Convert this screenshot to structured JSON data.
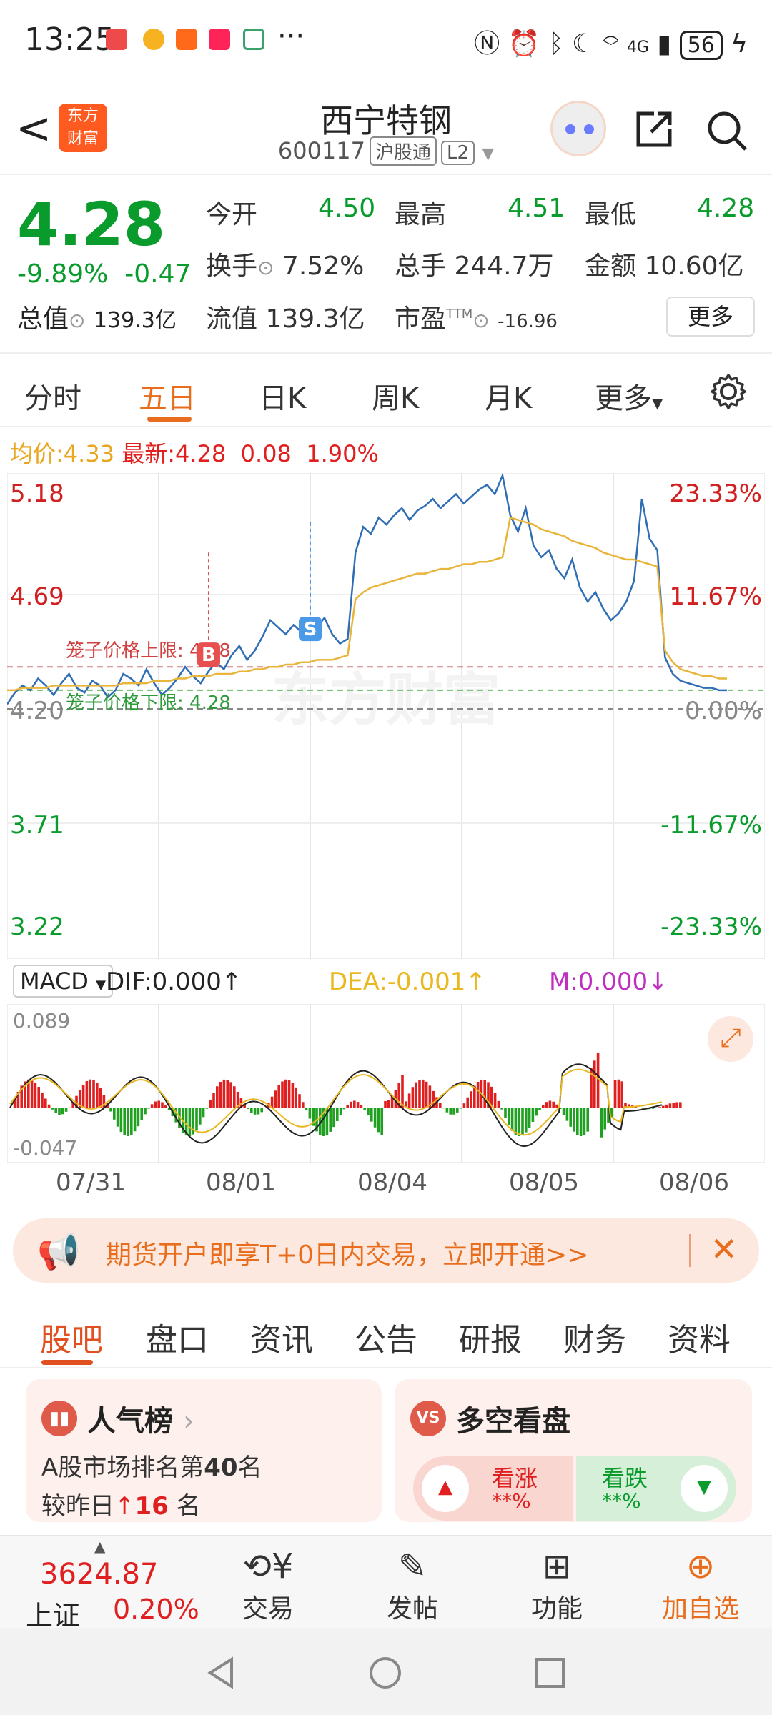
{
  "status_bar": {
    "time": "13:25",
    "battery": "56",
    "signal": "4G"
  },
  "header": {
    "back": "<",
    "logo_line1": "东方",
    "logo_line2": "财富",
    "stock_name": "西宁特钢",
    "stock_code": "600117",
    "tag_hgt": "沪股通",
    "tag_level": "L2"
  },
  "quote": {
    "price": "4.28",
    "change_pct": "-9.89%",
    "change": "-0.47",
    "open_label": "今开",
    "open": "4.50",
    "high_label": "最高",
    "high": "4.51",
    "low_label": "最低",
    "low": "4.28",
    "turnover_label": "换手",
    "turnover": "7.52%",
    "volume_label": "总手",
    "volume": "244.7万",
    "amount_label": "金额",
    "amount": "10.60亿",
    "mktcap_label": "总值",
    "mktcap": "139.3亿",
    "float_label": "流值",
    "float": "139.3亿",
    "pe_label": "市盈",
    "pe_sup": "TTM",
    "pe": "-16.96",
    "more": "更多"
  },
  "tabs": [
    "分时",
    "五日",
    "日K",
    "周K",
    "月K",
    "更多"
  ],
  "avg_line": {
    "avg_label": "均价:",
    "avg": "4.33",
    "latest_label": "最新:",
    "latest": "4.28",
    "diff": "0.08",
    "diff_pct": "1.90%"
  },
  "chart_data": {
    "type": "line",
    "y_left_ticks": [
      "5.18",
      "4.69",
      "4.20",
      "3.71",
      "3.22"
    ],
    "y_right_ticks": [
      "23.33%",
      "11.67%",
      "0.00%",
      "-11.67%",
      "-23.33%"
    ],
    "x_labels": [
      "07/31",
      "08/01",
      "08/04",
      "08/05",
      "08/06"
    ],
    "upper_limit_label": "笼子价格上限: 4.38",
    "lower_limit_label": "笼子价格下限: 4.28",
    "buy_marker": "B",
    "sell_marker": "S",
    "watermark": "东方财富",
    "ylim": [
      3.22,
      5.18
    ],
    "series": [
      {
        "name": "price",
        "color": "#2f6db5",
        "values": [
          4.22,
          4.27,
          4.3,
          4.28,
          4.33,
          4.3,
          4.26,
          4.31,
          4.35,
          4.29,
          4.27,
          4.32,
          4.3,
          4.25,
          4.28,
          4.35,
          4.33,
          4.3,
          4.37,
          4.31,
          4.26,
          4.29,
          4.33,
          4.38,
          4.34,
          4.31,
          4.36,
          4.4,
          4.37,
          4.43,
          4.47,
          4.41,
          4.45,
          4.51,
          4.58,
          4.55,
          4.52,
          4.56,
          4.53,
          4.57,
          4.55,
          4.59,
          4.52,
          4.48,
          4.5,
          4.87,
          4.98,
          4.95,
          5.02,
          4.99,
          5.03,
          5.06,
          5.01,
          5.05,
          5.07,
          5.1,
          5.06,
          5.09,
          5.12,
          5.08,
          5.11,
          5.14,
          5.16,
          5.12,
          5.2,
          5.03,
          4.96,
          5.06,
          4.9,
          4.85,
          4.88,
          4.8,
          4.76,
          4.84,
          4.72,
          4.66,
          4.7,
          4.63,
          4.58,
          4.61,
          4.66,
          4.75,
          5.1,
          4.93,
          4.88,
          4.42,
          4.35,
          4.32,
          4.31,
          4.3,
          4.29,
          4.29,
          4.28,
          4.28
        ]
      },
      {
        "name": "avg",
        "color": "#e9b43a",
        "values": [
          4.28,
          4.28,
          4.29,
          4.29,
          4.29,
          4.29,
          4.3,
          4.3,
          4.3,
          4.3,
          4.3,
          4.3,
          4.3,
          4.3,
          4.3,
          4.31,
          4.31,
          4.31,
          4.31,
          4.32,
          4.32,
          4.32,
          4.33,
          4.33,
          4.34,
          4.34,
          4.34,
          4.35,
          4.35,
          4.35,
          4.36,
          4.36,
          4.37,
          4.37,
          4.38,
          4.38,
          4.39,
          4.39,
          4.4,
          4.4,
          4.41,
          4.41,
          4.41,
          4.42,
          4.43,
          4.67,
          4.7,
          4.72,
          4.73,
          4.74,
          4.75,
          4.76,
          4.77,
          4.78,
          4.78,
          4.79,
          4.8,
          4.8,
          4.81,
          4.82,
          4.82,
          4.83,
          4.83,
          4.84,
          4.85,
          5.02,
          5.01,
          5.0,
          4.99,
          4.97,
          4.96,
          4.95,
          4.94,
          4.92,
          4.91,
          4.9,
          4.89,
          4.87,
          4.86,
          4.85,
          4.84,
          4.84,
          4.83,
          4.82,
          4.81,
          4.45,
          4.4,
          4.37,
          4.36,
          4.35,
          4.34,
          4.34,
          4.33,
          4.33
        ]
      }
    ]
  },
  "macd": {
    "selector": "MACD",
    "dif": "DIF:0.000",
    "dea": "DEA:-0.001",
    "m": "M:0.000",
    "top": "0.089",
    "bottom": "-0.047",
    "ylim": [
      -0.047,
      0.089
    ]
  },
  "ad": {
    "text": "期货开户即享T+0日内交易，立即开通>>"
  },
  "bottom_tabs": [
    "股吧",
    "盘口",
    "资讯",
    "公告",
    "研报",
    "财务",
    "资料"
  ],
  "cards": {
    "popular_title": "人气榜",
    "popular_line1_prefix": "A股市场排名第",
    "popular_rank": "40",
    "popular_line1_suffix": "名",
    "popular_line2_prefix": "较昨日",
    "popular_change": "16",
    "popular_line2_suffix": " 名",
    "vs_title": "多空看盘",
    "vs_icon": "VS",
    "bull_label": "看涨",
    "bull_val": "**%",
    "bear_label": "看跌",
    "bear_val": "**%"
  },
  "nav": {
    "index_value": "3624.87",
    "index_name": "上证",
    "index_pct": "0.20%",
    "trade": "交易",
    "post": "发帖",
    "func": "功能",
    "add": "加自选"
  }
}
